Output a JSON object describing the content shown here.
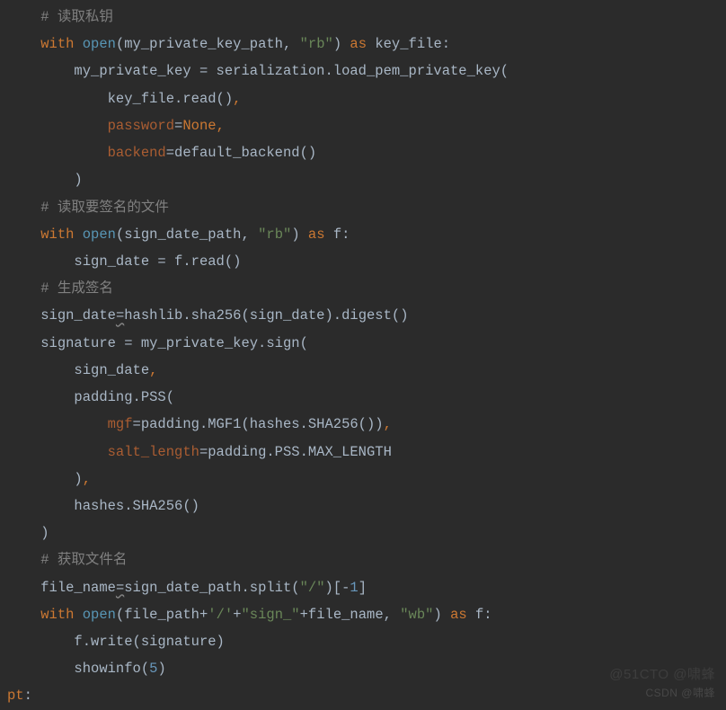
{
  "lang": "python",
  "lines": [
    {
      "indent": 1,
      "tokens": [
        {
          "t": "# 读取私钥",
          "cls": "c"
        }
      ]
    },
    {
      "indent": 1,
      "tokens": [
        {
          "t": "with ",
          "cls": "kw"
        },
        {
          "t": "open",
          "cls": "fn"
        },
        {
          "t": "(my_private_key_path",
          "cls": "p"
        },
        {
          "t": ", ",
          "cls": "p"
        },
        {
          "t": "\"rb\"",
          "cls": "s"
        },
        {
          "t": ") ",
          "cls": "p"
        },
        {
          "t": "as ",
          "cls": "kw"
        },
        {
          "t": "key_file:",
          "cls": "p"
        }
      ]
    },
    {
      "indent": 2,
      "tokens": [
        {
          "t": "my_private_key = serialization.load_pem_private_key(",
          "cls": "p"
        }
      ]
    },
    {
      "indent": 3,
      "tokens": [
        {
          "t": "key_file.read()",
          "cls": "p"
        },
        {
          "t": ",",
          "cls": "kw"
        }
      ]
    },
    {
      "indent": 3,
      "tokens": [
        {
          "t": "password",
          "cls": "arg"
        },
        {
          "t": "=",
          "cls": "p"
        },
        {
          "t": "None",
          "cls": "kw"
        },
        {
          "t": ",",
          "cls": "kw"
        }
      ]
    },
    {
      "indent": 3,
      "tokens": [
        {
          "t": "backend",
          "cls": "arg"
        },
        {
          "t": "=default_backend()",
          "cls": "p"
        }
      ]
    },
    {
      "indent": 2,
      "tokens": [
        {
          "t": ")",
          "cls": "p"
        }
      ]
    },
    {
      "indent": 1,
      "tokens": [
        {
          "t": "# 读取要签名的文件",
          "cls": "c"
        }
      ]
    },
    {
      "indent": 1,
      "tokens": [
        {
          "t": "with ",
          "cls": "kw"
        },
        {
          "t": "open",
          "cls": "fn"
        },
        {
          "t": "(sign_date_path",
          "cls": "p"
        },
        {
          "t": ", ",
          "cls": "p"
        },
        {
          "t": "\"rb\"",
          "cls": "s"
        },
        {
          "t": ") ",
          "cls": "p"
        },
        {
          "t": "as ",
          "cls": "kw"
        },
        {
          "t": "f:",
          "cls": "p"
        }
      ]
    },
    {
      "indent": 2,
      "tokens": [
        {
          "t": "sign_date = f.read()",
          "cls": "p"
        }
      ]
    },
    {
      "indent": 1,
      "tokens": [
        {
          "t": "# 生成签名",
          "cls": "c"
        }
      ]
    },
    {
      "indent": 1,
      "tokens": [
        {
          "t": "sign_date",
          "cls": "p"
        },
        {
          "t": "=",
          "cls": "p",
          "ul": true
        },
        {
          "t": "hashlib.sha256(sign_date).digest()",
          "cls": "p"
        }
      ]
    },
    {
      "indent": 1,
      "tokens": [
        {
          "t": "signature = my_private_key.sign(",
          "cls": "p"
        }
      ]
    },
    {
      "indent": 2,
      "tokens": [
        {
          "t": "sign_date",
          "cls": "p"
        },
        {
          "t": ",",
          "cls": "kw"
        }
      ]
    },
    {
      "indent": 2,
      "tokens": [
        {
          "t": "padding.PSS(",
          "cls": "p"
        }
      ]
    },
    {
      "indent": 3,
      "tokens": [
        {
          "t": "mgf",
          "cls": "arg"
        },
        {
          "t": "=padding.MGF1(hashes.SHA256())",
          "cls": "p"
        },
        {
          "t": ",",
          "cls": "kw"
        }
      ]
    },
    {
      "indent": 3,
      "tokens": [
        {
          "t": "salt_length",
          "cls": "arg"
        },
        {
          "t": "=padding.PSS.MAX_LENGTH",
          "cls": "p"
        }
      ]
    },
    {
      "indent": 2,
      "tokens": [
        {
          "t": ")",
          "cls": "p"
        },
        {
          "t": ",",
          "cls": "kw"
        }
      ]
    },
    {
      "indent": 2,
      "tokens": [
        {
          "t": "hashes.SHA256()",
          "cls": "p"
        }
      ]
    },
    {
      "indent": 1,
      "tokens": [
        {
          "t": ")",
          "cls": "p"
        }
      ]
    },
    {
      "indent": 1,
      "tokens": [
        {
          "t": "# 获取文件名",
          "cls": "c"
        }
      ]
    },
    {
      "indent": 1,
      "tokens": [
        {
          "t": "file_name",
          "cls": "p"
        },
        {
          "t": "=",
          "cls": "p",
          "ul": true
        },
        {
          "t": "sign_date_path.split(",
          "cls": "p"
        },
        {
          "t": "\"/\"",
          "cls": "s"
        },
        {
          "t": ")[-",
          "cls": "p"
        },
        {
          "t": "1",
          "cls": "num"
        },
        {
          "t": "]",
          "cls": "p"
        }
      ]
    },
    {
      "indent": 1,
      "tokens": [
        {
          "t": "with ",
          "cls": "kw"
        },
        {
          "t": "open",
          "cls": "fn"
        },
        {
          "t": "(file_path+",
          "cls": "p"
        },
        {
          "t": "'/'",
          "cls": "s"
        },
        {
          "t": "+",
          "cls": "p"
        },
        {
          "t": "\"sign_\"",
          "cls": "s"
        },
        {
          "t": "+file_name",
          "cls": "p"
        },
        {
          "t": ", ",
          "cls": "p"
        },
        {
          "t": "\"wb\"",
          "cls": "s"
        },
        {
          "t": ") ",
          "cls": "p"
        },
        {
          "t": "as ",
          "cls": "kw"
        },
        {
          "t": "f:",
          "cls": "p"
        }
      ]
    },
    {
      "indent": 2,
      "tokens": [
        {
          "t": "f.write(signature)",
          "cls": "p"
        }
      ]
    },
    {
      "indent": 2,
      "tokens": [
        {
          "t": "showinfo(",
          "cls": "p"
        },
        {
          "t": "5",
          "cls": "num"
        },
        {
          "t": ")",
          "cls": "p"
        }
      ]
    },
    {
      "indent": 0,
      "tokens": [
        {
          "t": "pt",
          "cls": "kw"
        },
        {
          "t": ":",
          "cls": "p"
        }
      ]
    }
  ],
  "indent_str": "    ",
  "watermarks": {
    "top": "@51CTO @啸蜂",
    "bottom": "CSDN @啸蜂"
  }
}
